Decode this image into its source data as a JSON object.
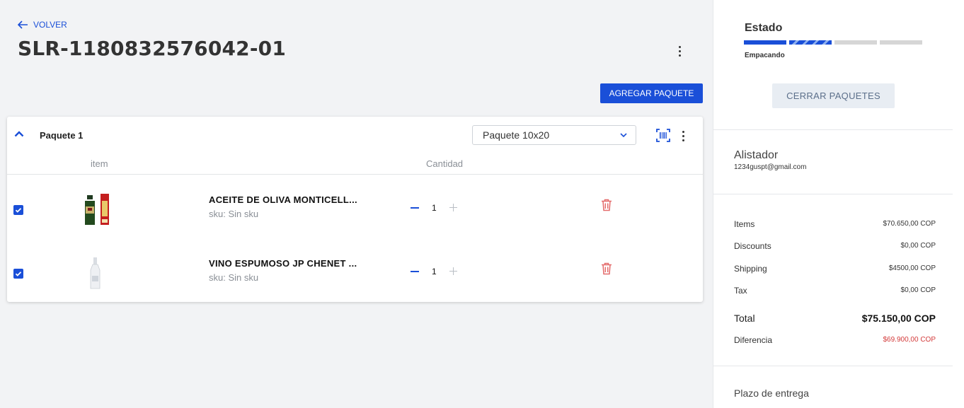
{
  "header": {
    "back_label": "VOLVER",
    "order_id": "SLR-1180832576042-01",
    "add_package_label": "AGREGAR PAQUETE"
  },
  "package": {
    "name": "Paquete 1",
    "size_selected": "Paquete 10x20",
    "columns": {
      "item": "item",
      "quantity": "Cantidad"
    },
    "items": [
      {
        "name": "ACEITE DE OLIVA MONTICELL...",
        "sku": "sku: Sin sku",
        "quantity": "1",
        "checked": true
      },
      {
        "name": "VINO ESPUMOSO JP CHENET ...",
        "sku": "sku: Sin sku",
        "quantity": "1",
        "checked": true
      }
    ]
  },
  "sidebar": {
    "status_title": "Estado",
    "status_label": "Empacando",
    "status_steps_total": 4,
    "status_steps_completed": 1,
    "status_step_in_progress": 2,
    "close_packages_label": "CERRAR PAQUETES",
    "picker_title": "Alistador",
    "picker_email": "1234guspt@gmail.com",
    "summary": {
      "items_label": "Items",
      "items_value": "$70.650,00 COP",
      "discounts_label": "Discounts",
      "discounts_value": "$0,00 COP",
      "shipping_label": "Shipping",
      "shipping_value": "$4500,00 COP",
      "tax_label": "Tax",
      "tax_value": "$0,00 COP",
      "total_label": "Total",
      "total_value": "$75.150,00 COP",
      "difference_label": "Diferencia",
      "difference_value": "$69.900,00 COP"
    },
    "delivery_title": "Plazo de entrega"
  },
  "colors": {
    "accent": "#1a4fd8",
    "danger": "#d33a3a",
    "annotation_arrow": "#7a1515"
  }
}
